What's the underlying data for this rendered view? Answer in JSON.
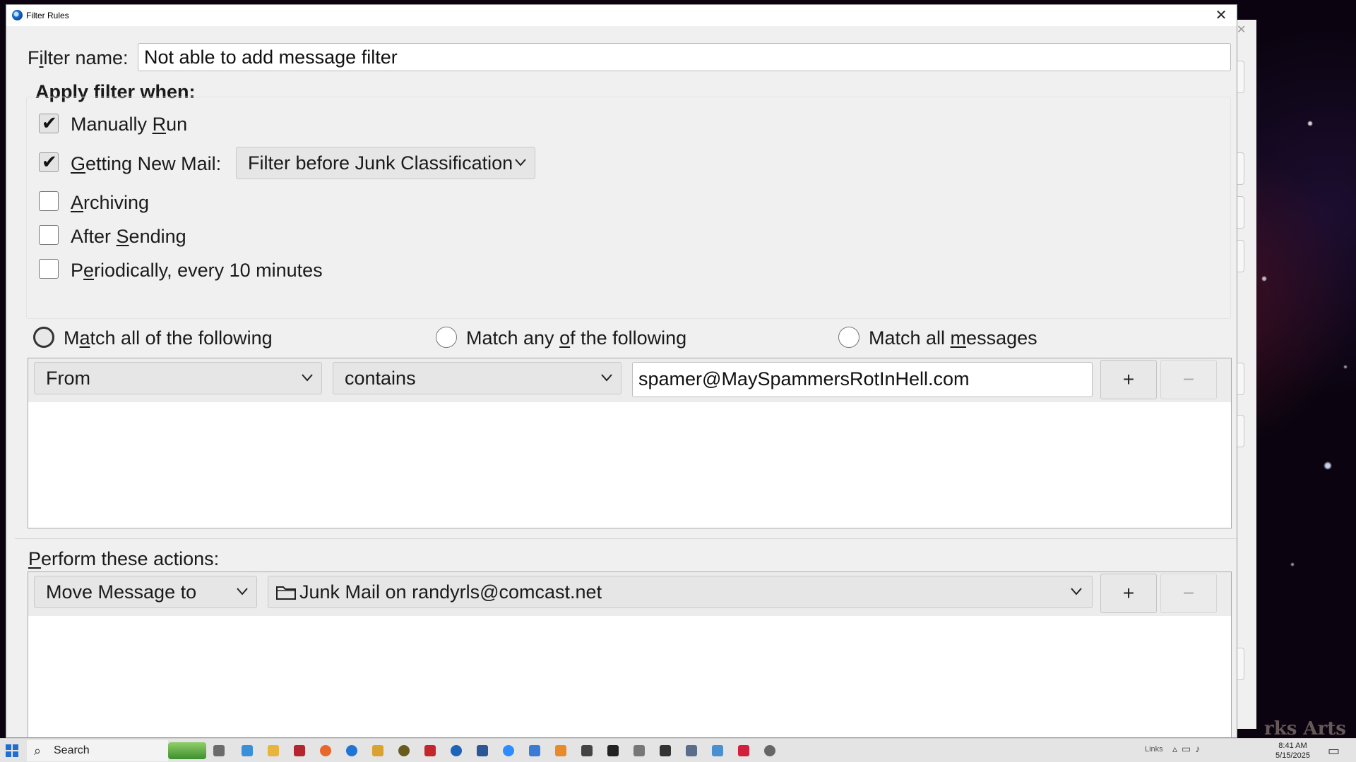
{
  "window": {
    "title": "Filter Rules",
    "close_glyph": "✕"
  },
  "filter_name": {
    "label_pre": "F",
    "label_underlined": "i",
    "label_post": "lter name:",
    "value": "Not able to add message filter"
  },
  "apply_when": {
    "heading": "Apply filter when:",
    "options": [
      {
        "pre": "Manually ",
        "ul": "R",
        "post": "un",
        "checked": true
      },
      {
        "pre": "",
        "ul": "G",
        "post": "etting New Mail:",
        "checked": true
      },
      {
        "pre": "",
        "ul": "A",
        "post": "rchiving",
        "checked": false
      },
      {
        "pre": "After ",
        "ul": "S",
        "post": "ending",
        "checked": false
      },
      {
        "pre": "P",
        "ul": "e",
        "post": "riodically, every 10 minutes",
        "checked": false
      }
    ],
    "getting_mail_dropdown": "Filter before Junk Classification",
    "check_glyph": "✔"
  },
  "match": {
    "options": [
      {
        "pre": "M",
        "ul": "a",
        "post": "tch all of the following",
        "selected": true
      },
      {
        "pre": "Match any ",
        "ul": "o",
        "post": "f the following",
        "selected": false
      },
      {
        "pre": "Match all ",
        "ul": "m",
        "post": "essages",
        "selected": false
      }
    ]
  },
  "rule": {
    "field": "From",
    "operator": "contains",
    "value": "spamer@MaySpammersRotInHell.com",
    "add_label": "+",
    "remove_label": "−"
  },
  "actions": {
    "heading_ul": "P",
    "heading_post": "erform these actions:",
    "action": "Move Message to",
    "target": "Junk Mail on randyrls@comcast.net",
    "target_icon": "folder-icon",
    "add_label": "+",
    "remove_label": "−"
  },
  "taskbar": {
    "search_label": "Search",
    "links_label": "Links",
    "clock_time": "8:41 AM",
    "clock_date": "5/15/2025"
  },
  "background": {
    "watermark": "rks Arts",
    "close_glyph": "✕"
  }
}
